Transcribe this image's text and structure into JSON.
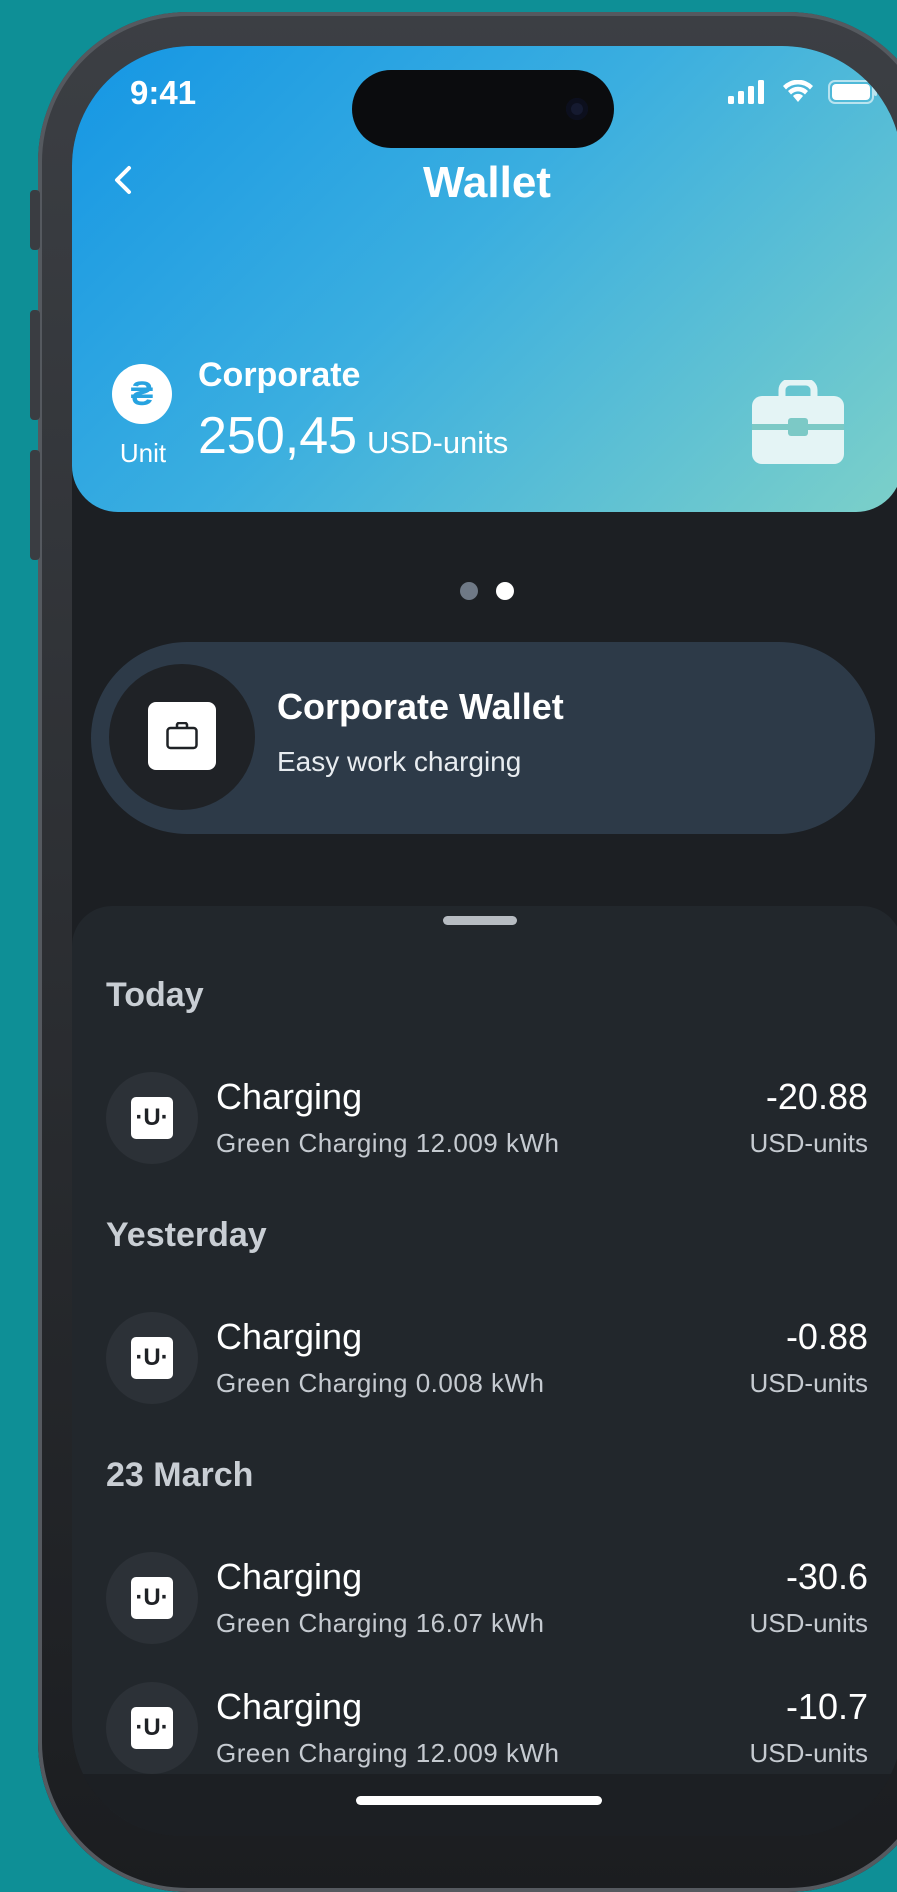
{
  "status_bar": {
    "time": "9:41"
  },
  "header": {
    "title": "Wallet",
    "unit_symbol": "₴",
    "unit_label": "Unit",
    "wallet_name": "Corporate",
    "balance": "250,45",
    "balance_unit": "USD-units"
  },
  "pager": {
    "count": 2,
    "active_index": 1
  },
  "promo": {
    "title": "Corporate Wallet",
    "subtitle": "Easy work charging"
  },
  "transactions": {
    "groups": [
      {
        "label": "Today",
        "items": [
          {
            "title": "Charging",
            "subtitle": "Green Charging 12.009 kWh",
            "amount": "-20.88",
            "unit": "USD-units"
          }
        ]
      },
      {
        "label": "Yesterday",
        "items": [
          {
            "title": "Charging",
            "subtitle": "Green Charging 0.008 kWh",
            "amount": "-0.88",
            "unit": "USD-units"
          }
        ]
      },
      {
        "label": "23 March",
        "items": [
          {
            "title": "Charging",
            "subtitle": "Green Charging 16.07 kWh",
            "amount": "-30.6",
            "unit": "USD-units"
          },
          {
            "title": "Charging",
            "subtitle": "Green Charging 12.009 kWh",
            "amount": "-10.7",
            "unit": "USD-units"
          }
        ]
      }
    ],
    "item_icon_glyph": "·U·"
  },
  "colors": {
    "background": "#0e8f96",
    "header_gradient_start": "#1596e4",
    "header_gradient_end": "#7cd0c9",
    "sheet": "#22272c",
    "promo": "#2d3a48"
  }
}
